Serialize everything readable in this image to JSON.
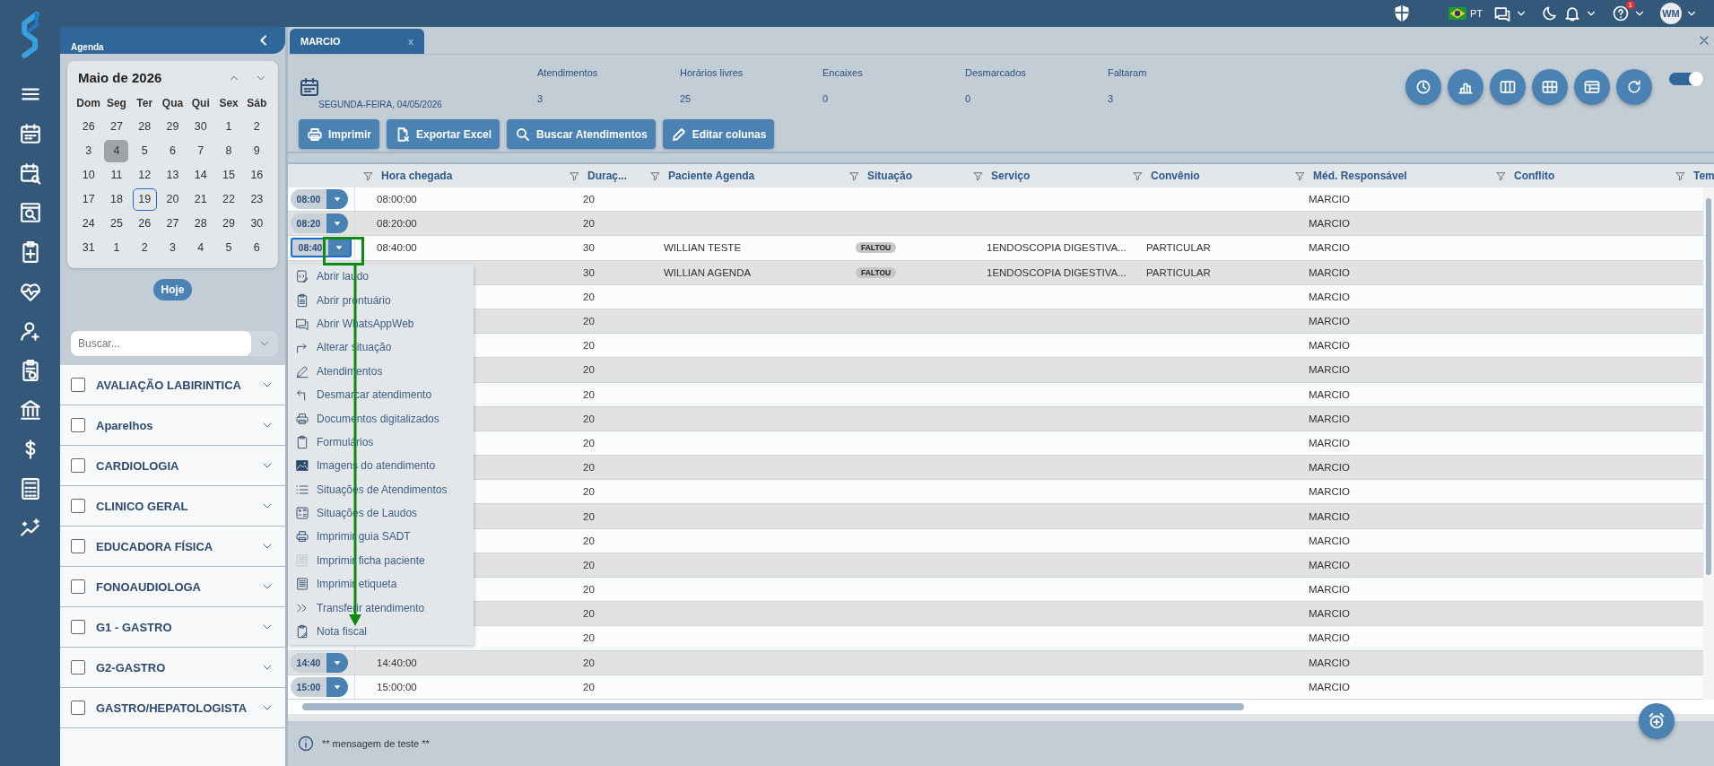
{
  "top_bar": {
    "language": "PT",
    "help_badge": "1",
    "avatar": "WM"
  },
  "sidebar": {
    "title": "Agenda",
    "calendar": {
      "month": "Maio de 2026",
      "weekdays": [
        "Dom",
        "Seg",
        "Ter",
        "Qua",
        "Qui",
        "Sex",
        "Sáb"
      ],
      "days": [
        {
          "label": "26",
          "selected": false,
          "today": false
        },
        {
          "label": "27",
          "selected": false,
          "today": false
        },
        {
          "label": "28",
          "selected": false,
          "today": false
        },
        {
          "label": "29",
          "selected": false,
          "today": false
        },
        {
          "label": "30",
          "selected": false,
          "today": false
        },
        {
          "label": "1",
          "selected": false,
          "today": false
        },
        {
          "label": "2",
          "selected": false,
          "today": false
        },
        {
          "label": "3",
          "selected": false,
          "today": false
        },
        {
          "label": "4",
          "selected": true,
          "today": false
        },
        {
          "label": "5",
          "selected": false,
          "today": false
        },
        {
          "label": "6",
          "selected": false,
          "today": false
        },
        {
          "label": "7",
          "selected": false,
          "today": false
        },
        {
          "label": "8",
          "selected": false,
          "today": false
        },
        {
          "label": "9",
          "selected": false,
          "today": false
        },
        {
          "label": "10",
          "selected": false,
          "today": false
        },
        {
          "label": "11",
          "selected": false,
          "today": false
        },
        {
          "label": "12",
          "selected": false,
          "today": false
        },
        {
          "label": "13",
          "selected": false,
          "today": false
        },
        {
          "label": "14",
          "selected": false,
          "today": false
        },
        {
          "label": "15",
          "selected": false,
          "today": false
        },
        {
          "label": "16",
          "selected": false,
          "today": false
        },
        {
          "label": "17",
          "selected": false,
          "today": false
        },
        {
          "label": "18",
          "selected": false,
          "today": false
        },
        {
          "label": "19",
          "selected": false,
          "today": true
        },
        {
          "label": "20",
          "selected": false,
          "today": false
        },
        {
          "label": "21",
          "selected": false,
          "today": false
        },
        {
          "label": "22",
          "selected": false,
          "today": false
        },
        {
          "label": "23",
          "selected": false,
          "today": false
        },
        {
          "label": "24",
          "selected": false,
          "today": false
        },
        {
          "label": "25",
          "selected": false,
          "today": false
        },
        {
          "label": "26",
          "selected": false,
          "today": false
        },
        {
          "label": "27",
          "selected": false,
          "today": false
        },
        {
          "label": "28",
          "selected": false,
          "today": false
        },
        {
          "label": "29",
          "selected": false,
          "today": false
        },
        {
          "label": "30",
          "selected": false,
          "today": false
        },
        {
          "label": "31",
          "selected": false,
          "today": false
        },
        {
          "label": "1",
          "selected": false,
          "today": false
        },
        {
          "label": "2",
          "selected": false,
          "today": false
        },
        {
          "label": "3",
          "selected": false,
          "today": false
        },
        {
          "label": "4",
          "selected": false,
          "today": false
        },
        {
          "label": "5",
          "selected": false,
          "today": false
        },
        {
          "label": "6",
          "selected": false,
          "today": false
        }
      ]
    },
    "today_button": "Hoje",
    "search": {
      "placeholder": "Buscar..."
    },
    "groups": [
      {
        "label": "AVALIAÇÃO LABIRINTICA",
        "checked": false
      },
      {
        "label": "Aparelhos",
        "checked": false
      },
      {
        "label": "CARDIOLOGIA",
        "checked": false
      },
      {
        "label": "CLINICO GERAL",
        "checked": false
      },
      {
        "label": "EDUCADORA FÍSICA",
        "checked": false
      },
      {
        "label": "FONOAUDIOLOGA",
        "checked": false
      },
      {
        "label": "G1 - GASTRO",
        "checked": false
      },
      {
        "label": "G2-GASTRO",
        "checked": false
      },
      {
        "label": "GASTRO/HEPATOLOGISTA",
        "checked": false
      }
    ]
  },
  "tab": {
    "label": "MARCIO",
    "close": "x"
  },
  "date": "SEGUNDA-FEIRA, 04/05/2026",
  "stats": [
    {
      "label": "Atendimentos",
      "value": "3"
    },
    {
      "label": "Horários livres",
      "value": "25"
    },
    {
      "label": "Encaixes",
      "value": "0"
    },
    {
      "label": "Desmarcados",
      "value": "0"
    },
    {
      "label": "Faltaram",
      "value": "3"
    }
  ],
  "actions": [
    {
      "label": "Imprimir",
      "kind": "print"
    },
    {
      "label": "Exportar Excel",
      "kind": "export"
    },
    {
      "label": "Buscar Atendimentos",
      "kind": "search"
    },
    {
      "label": "Editar colunas",
      "kind": "edit"
    }
  ],
  "toggle": {
    "on": true
  },
  "table": {
    "columns": [
      "Hora chegada",
      "Duraç...",
      "Paciente Agenda",
      "Situação",
      "Serviço",
      "Convênio",
      "Méd. Responsável",
      "Conflito",
      "Tem"
    ],
    "rows": [
      {
        "time": "08:00",
        "arrival": "08:00:00",
        "duration": "20",
        "doctor": "MARCIO",
        "selected": false
      },
      {
        "time": "08:20",
        "arrival": "08:20:00",
        "duration": "20",
        "doctor": "MARCIO",
        "selected": false
      },
      {
        "time": "08:40",
        "arrival": "08:40:00",
        "duration": "30",
        "patient": "WILLIAN TESTE",
        "status": "FALTOU",
        "service": "1ENDOSCOPIA DIGESTIVA...",
        "insurance": "PARTICULAR",
        "doctor": "MARCIO",
        "selected": true
      },
      {
        "duration": "30",
        "patient": "WILLIAN AGENDA",
        "status": "FALTOU",
        "service": "1ENDOSCOPIA DIGESTIVA...",
        "insurance": "PARTICULAR",
        "doctor": "MARCIO",
        "selected": false
      },
      {
        "duration": "20",
        "doctor": "MARCIO",
        "selected": false
      },
      {
        "duration": "20",
        "doctor": "MARCIO",
        "selected": false
      },
      {
        "duration": "20",
        "doctor": "MARCIO",
        "selected": false
      },
      {
        "duration": "20",
        "doctor": "MARCIO",
        "selected": false
      },
      {
        "duration": "20",
        "doctor": "MARCIO",
        "selected": false
      },
      {
        "duration": "20",
        "doctor": "MARCIO",
        "selected": false
      },
      {
        "duration": "20",
        "doctor": "MARCIO",
        "selected": false
      },
      {
        "duration": "20",
        "doctor": "MARCIO",
        "selected": false
      },
      {
        "duration": "20",
        "doctor": "MARCIO",
        "selected": false
      },
      {
        "duration": "20",
        "doctor": "MARCIO",
        "selected": false
      },
      {
        "duration": "20",
        "doctor": "MARCIO",
        "selected": false
      },
      {
        "duration": "20",
        "doctor": "MARCIO",
        "selected": false
      },
      {
        "duration": "20",
        "doctor": "MARCIO",
        "selected": false
      },
      {
        "duration": "20",
        "doctor": "MARCIO",
        "selected": false
      },
      {
        "duration": "20",
        "doctor": "MARCIO",
        "selected": false
      },
      {
        "time": "14:40",
        "arrival": "14:40:00",
        "duration": "20",
        "doctor": "MARCIO",
        "selected": false
      },
      {
        "time": "15:00",
        "arrival": "15:00:00",
        "duration": "20",
        "doctor": "MARCIO",
        "selected": false
      }
    ]
  },
  "context_menu": {
    "items": [
      {
        "label": "Abrir laudo",
        "kind": "report"
      },
      {
        "label": "Abrir prontuário",
        "kind": "clipboard"
      },
      {
        "label": "Abrir WhatsAppWeb",
        "kind": "chat"
      },
      {
        "label": "Alterar situação",
        "kind": "share"
      },
      {
        "label": "Atendimentos",
        "kind": "pencil"
      },
      {
        "label": "Desmarcar atendimento",
        "kind": "undo"
      },
      {
        "label": "Documentos digitalizados",
        "kind": "print"
      },
      {
        "label": "Formulários",
        "kind": "blank"
      },
      {
        "label": "Imagens do atendimento",
        "kind": "image"
      },
      {
        "label": "Situações de Atendimentos",
        "kind": "list"
      },
      {
        "label": "Situações de Laudos",
        "kind": "status"
      },
      {
        "label": "Imprimir guia SADT",
        "kind": "print"
      },
      {
        "label": "Imprimir ficha paciente",
        "kind": "sheet"
      },
      {
        "label": "Imprimir etiqueta",
        "kind": "label"
      },
      {
        "label": "Transferir atendimento",
        "kind": "forward"
      },
      {
        "label": "Nota fiscal",
        "kind": "note"
      }
    ]
  },
  "footer": {
    "message": "** mensagem de teste **"
  }
}
